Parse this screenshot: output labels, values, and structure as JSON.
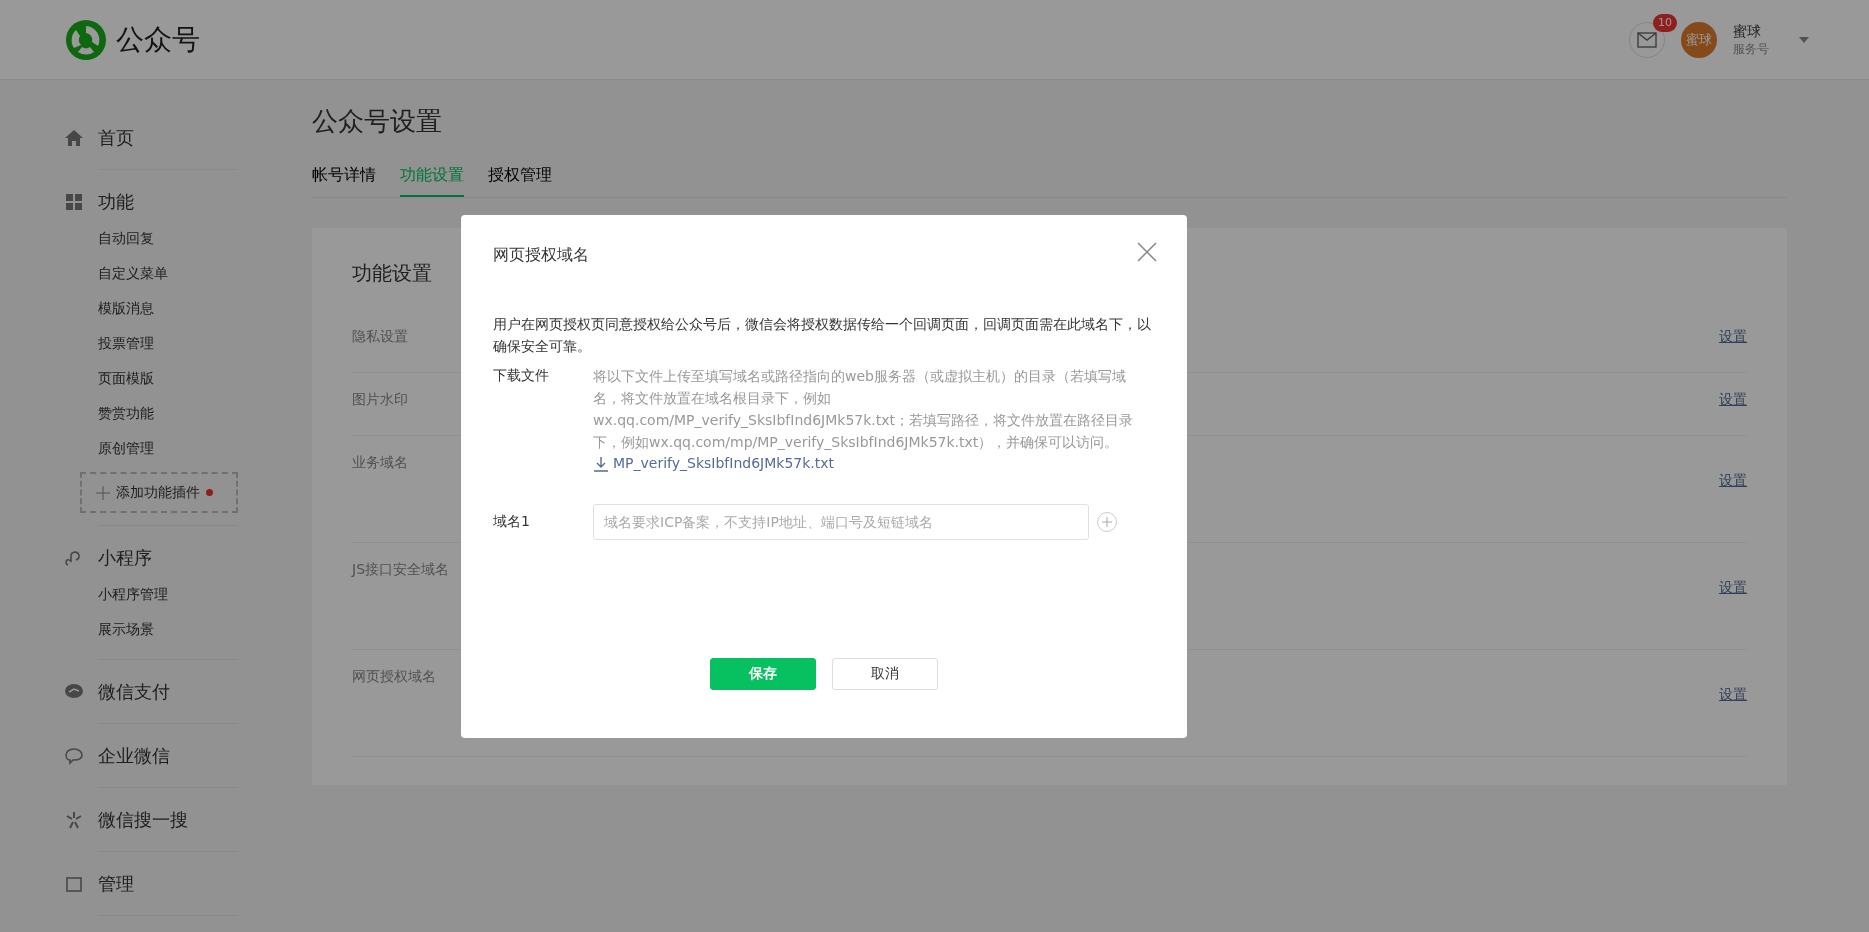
{
  "header": {
    "logo_text": "公众号",
    "mail_badge": "10",
    "avatar_text": "蜜球",
    "account_name": "蜜球",
    "account_type": "服务号"
  },
  "sidebar": {
    "groups": [
      {
        "label": "首页"
      },
      {
        "label": "功能",
        "children": [
          "自动回复",
          "自定义菜单",
          "模版消息",
          "投票管理",
          "页面模版",
          "赞赏功能",
          "原创管理"
        ],
        "add_plugin": "添加功能插件"
      },
      {
        "label": "小程序",
        "children": [
          "小程序管理",
          "展示场景"
        ]
      },
      {
        "label": "微信支付"
      },
      {
        "label": "企业微信"
      },
      {
        "label": "微信搜一搜"
      },
      {
        "label": "管理"
      }
    ]
  },
  "main": {
    "title": "公众号设置",
    "tabs": [
      {
        "label": "帐号详情",
        "selected": false
      },
      {
        "label": "功能设置",
        "selected": true
      },
      {
        "label": "授权管理",
        "selected": false
      }
    ],
    "card_title": "功能设置",
    "rows": [
      {
        "label": "隐私设置",
        "action": "设置"
      },
      {
        "label": "图片水印",
        "action": "设置"
      },
      {
        "label": "业务域名",
        "action": "设置"
      },
      {
        "label": "JS接口安全域名",
        "action": "设置"
      },
      {
        "label": "网页授权域名",
        "action": "设置"
      }
    ]
  },
  "dialog": {
    "title": "网页授权域名",
    "intro": "用户在网页授权页同意授权给公众号后，微信会将授权数据传给一个回调页面，回调页面需在此域名下，以确保安全可靠。",
    "download_label": "下载文件",
    "download_desc": "将以下文件上传至填写域名或路径指向的web服务器（或虚拟主机）的目录（若填写域名，将文件放置在域名根目录下，例如wx.qq.com/MP_verify_SksIbfInd6JMk57k.txt；若填写路径，将文件放置在路径目录下，例如wx.qq.com/mp/MP_verify_SksIbfInd6JMk57k.txt），并确保可以访问。",
    "download_file": "MP_verify_SksIbfInd6JMk57k.txt",
    "domain_label": "域名1",
    "domain_placeholder": "域名要求ICP备案，不支持IP地址、端口号及短链域名",
    "buttons": [
      {
        "label": "保存",
        "kind": "primary"
      },
      {
        "label": "取消",
        "kind": "default"
      }
    ]
  }
}
